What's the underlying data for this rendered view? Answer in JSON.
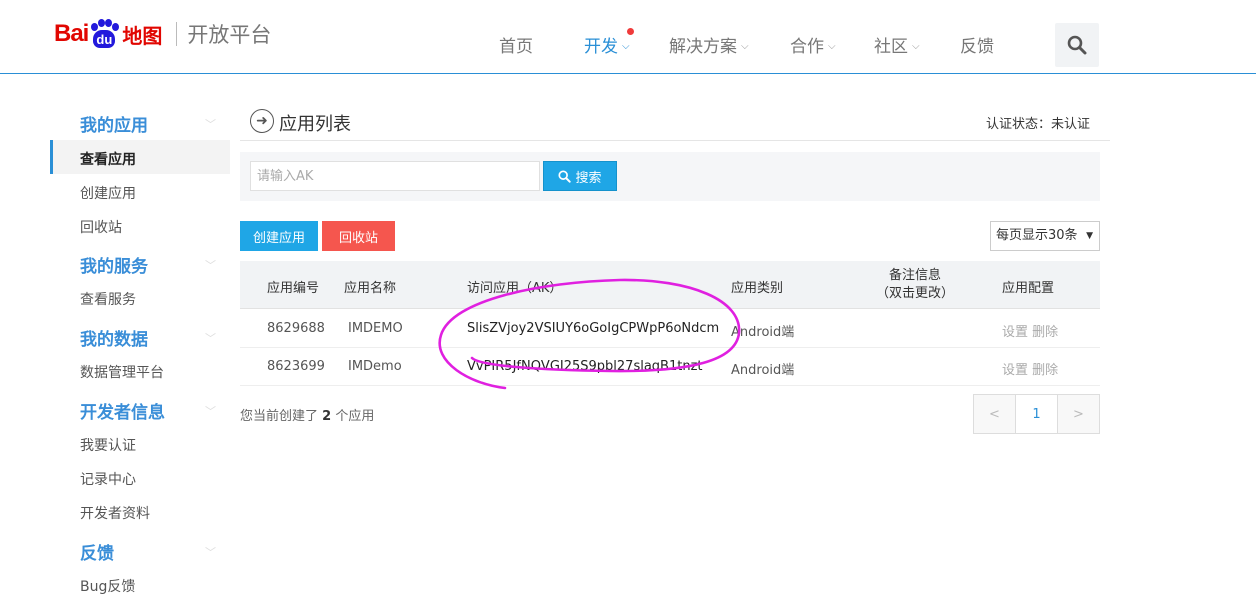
{
  "header": {
    "logo": {
      "bai": "Bai",
      "du": "du",
      "map": "地图",
      "title": "开放平台"
    },
    "nav": [
      {
        "label": "首页",
        "active": false,
        "dropdown": false
      },
      {
        "label": "开发",
        "active": true,
        "dropdown": true
      },
      {
        "label": "解决方案",
        "active": false,
        "dropdown": true
      },
      {
        "label": "合作",
        "active": false,
        "dropdown": true
      },
      {
        "label": "社区",
        "active": false,
        "dropdown": true
      },
      {
        "label": "反馈",
        "active": false,
        "dropdown": false
      }
    ],
    "chevron": "⌄"
  },
  "sidebar": {
    "groups": [
      {
        "title": "我的应用",
        "items": [
          "查看应用",
          "创建应用",
          "回收站"
        ]
      },
      {
        "title": "我的服务",
        "items": [
          "查看服务"
        ]
      },
      {
        "title": "我的数据",
        "items": [
          "数据管理平台"
        ]
      },
      {
        "title": "开发者信息",
        "items": [
          "我要认证",
          "记录中心",
          "开发者资料"
        ]
      },
      {
        "title": "反馈",
        "items": [
          "Bug反馈"
        ]
      }
    ]
  },
  "main": {
    "title": "应用列表",
    "cert_status": "认证状态：未认证",
    "search": {
      "placeholder": "请输入AK",
      "button": "搜索"
    },
    "create_button": "创建应用",
    "recycle_button": "回收站",
    "per_page": "每页显示30条",
    "table": {
      "headers": [
        "应用编号",
        "应用名称",
        "访问应用（AK）",
        "应用类别",
        "备注信息",
        "（双击更改）",
        "应用配置"
      ],
      "rows": [
        {
          "id": "8629688",
          "name": "IMDEMO",
          "ak": "SlisZVjoy2VSIUY6oGoIgCPWpP6oNdcm",
          "type": "Android端",
          "note": "",
          "set": "设置",
          "del": "删除"
        },
        {
          "id": "8623699",
          "name": "IMDemo",
          "ak": "VvPIR5JfNQVGI25S9pbl27slaqB1tnzt",
          "type": "Android端",
          "note": "",
          "set": "设置",
          "del": "删除"
        }
      ]
    },
    "summary": {
      "prefix": "您当前创建了",
      "count": "2",
      "suffix": "个应用"
    },
    "pager": {
      "prev": "<",
      "page": "1",
      "next": ">"
    }
  },
  "colors": {
    "accent": "#2a8fd6",
    "brand_red": "#e10601",
    "danger": "#f5564e",
    "annotation": "#e020e0"
  }
}
